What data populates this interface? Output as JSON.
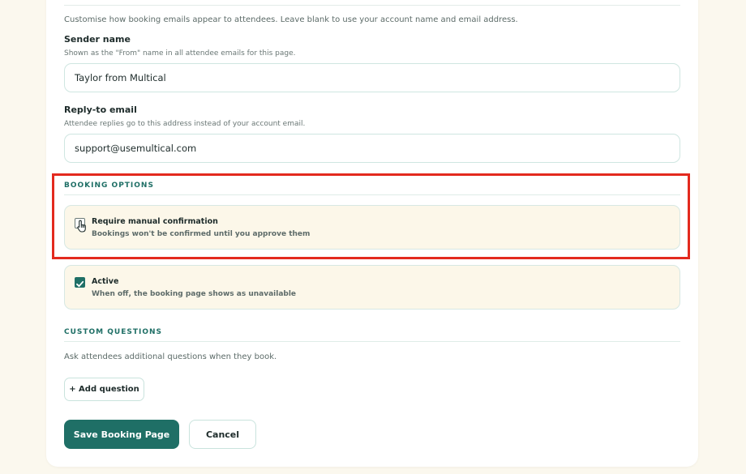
{
  "email_settings": {
    "description": "Customise how booking emails appear to attendees. Leave blank to use your account name and email address.",
    "sender_name": {
      "label": "Sender name",
      "hint": "Shown as the \"From\" name in all attendee emails for this page.",
      "value": "Taylor from Multical"
    },
    "reply_to": {
      "label": "Reply-to email",
      "hint": "Attendee replies go to this address instead of your account email.",
      "value": "support@usemultical.com"
    }
  },
  "booking_options": {
    "title": "BOOKING OPTIONS",
    "manual_confirmation": {
      "label": "Require manual confirmation",
      "description": "Bookings won't be confirmed until you approve them",
      "checked": false
    },
    "active": {
      "label": "Active",
      "description": "When off, the booking page shows as unavailable",
      "checked": true
    }
  },
  "custom_questions": {
    "title": "CUSTOM QUESTIONS",
    "description": "Ask attendees additional questions when they book.",
    "add_label": "+ Add question"
  },
  "actions": {
    "save_label": "Save Booking Page",
    "cancel_label": "Cancel"
  },
  "colors": {
    "accent": "#1f6f66",
    "highlight": "#e32a1e",
    "option_background": "#fcf7e9",
    "page_background": "#fbf8ee"
  }
}
